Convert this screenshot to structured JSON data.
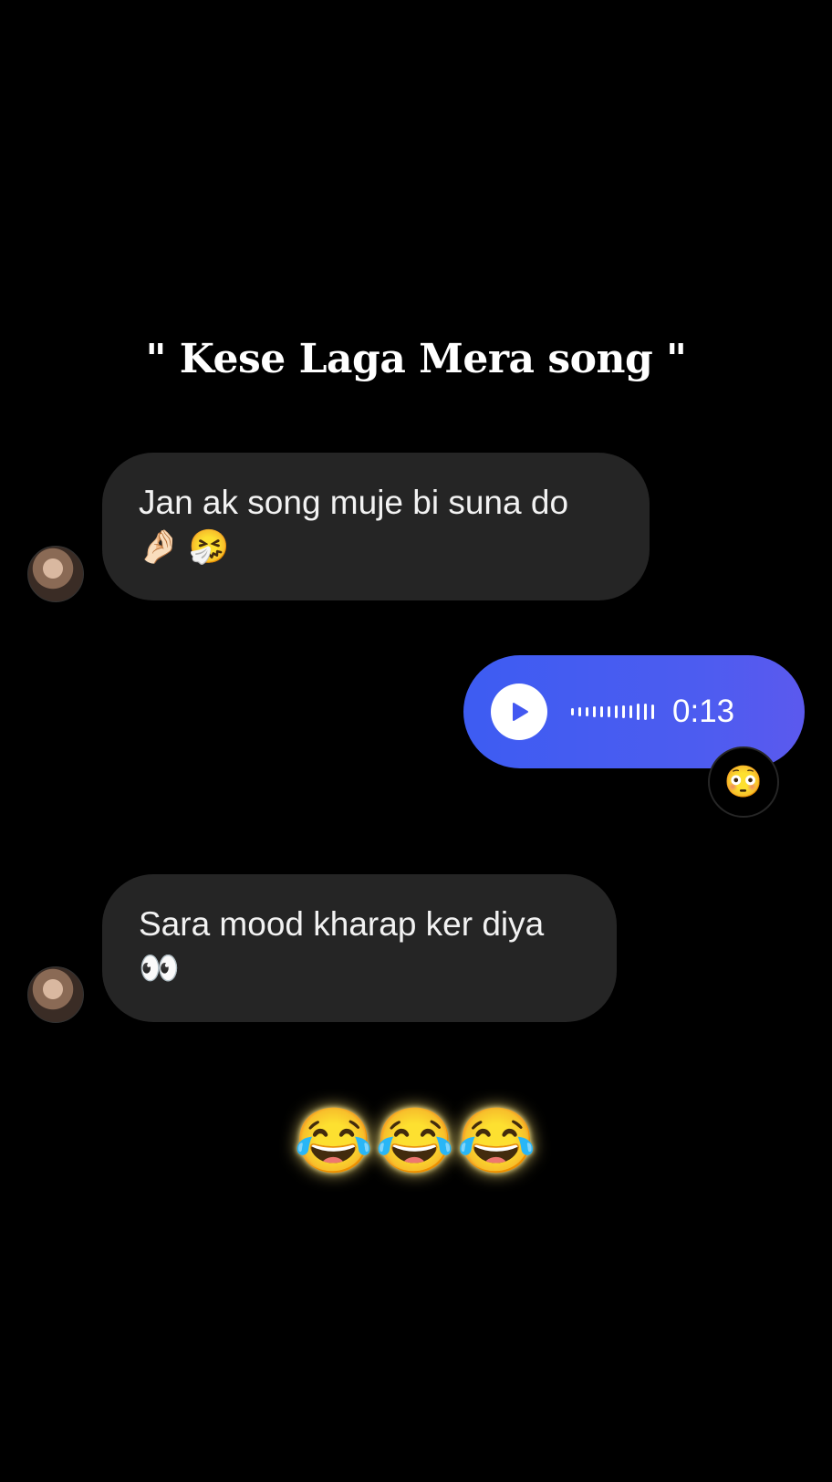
{
  "caption": "\" Kese Laga Mera song \"",
  "messages": [
    {
      "direction": "incoming",
      "text": "Jan ak song muje bi suna do",
      "emojis": "🤌🏻 🤧"
    },
    {
      "direction": "outgoing",
      "type": "voice",
      "duration": "0:13",
      "reaction": "😳"
    },
    {
      "direction": "incoming",
      "text": "Sara mood kharap ker diya",
      "emojis": "👀"
    }
  ],
  "overlay_emojis": "😂😂😂",
  "colors": {
    "background": "#000000",
    "incoming_bubble": "#252525",
    "outgoing_bubble": "#4358f1",
    "text": "#ffffff"
  },
  "icons": {
    "play": "play-icon",
    "waveform": "waveform-icon",
    "avatar": "avatar"
  }
}
